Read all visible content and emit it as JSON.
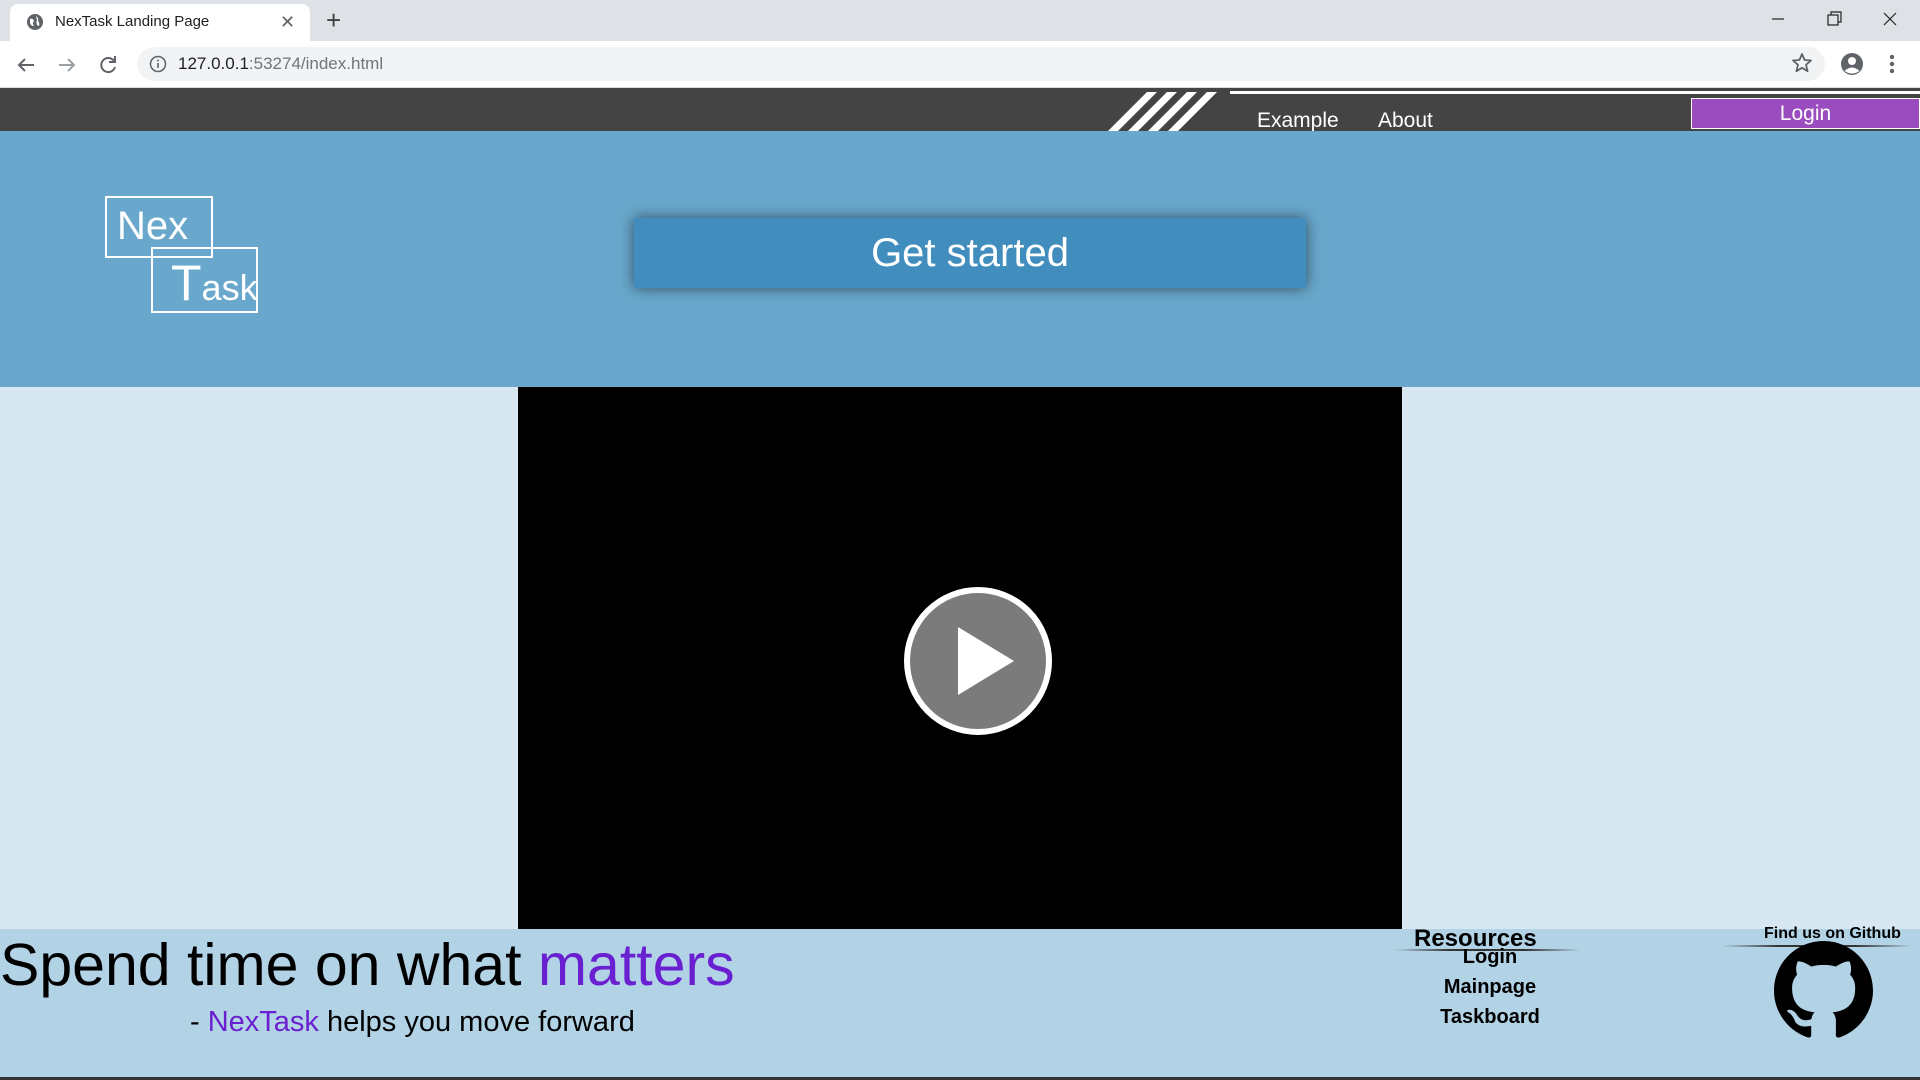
{
  "browser": {
    "tab_title": "NexTask Landing Page",
    "tab_close": "✕",
    "new_tab": "+",
    "url_host": "127.0.0.1",
    "url_rest": ":53274/index.html"
  },
  "nav": {
    "links": [
      "Example",
      "About"
    ],
    "login_label": "Login",
    "login_color": "#9b4dbf"
  },
  "hero": {
    "logo_top": "Nex",
    "logo_bottom_first": "T",
    "logo_bottom_rest": "ask",
    "cta_label": "Get started"
  },
  "video": {
    "state": "paused",
    "play_icon": "play-icon"
  },
  "footer": {
    "tagline_prefix": "Spend time on what ",
    "tagline_accent": "matters",
    "sub_prefix": "- ",
    "sub_brand": "NexTask",
    "sub_suffix": " helps you move forward",
    "accent_color": "#6a1fd0",
    "resources_title": "Resources",
    "resources_links": [
      "Login",
      "Mainpage",
      "Taskboard"
    ],
    "github_title": "Find us on Github",
    "github_icon": "github-icon"
  }
}
